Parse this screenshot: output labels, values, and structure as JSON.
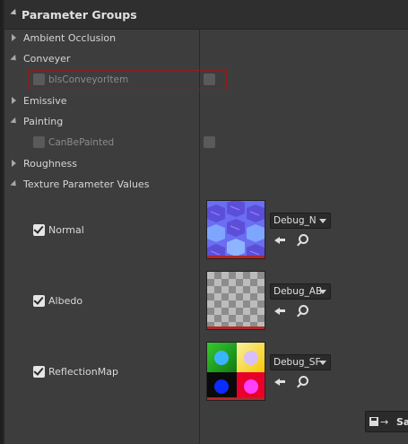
{
  "header": {
    "title": "Parameter Groups"
  },
  "groups": {
    "ambient_occlusion": "Ambient Occlusion",
    "conveyer": "Conveyer",
    "conveyer_param": "bIsConveyorItem",
    "emissive": "Emissive",
    "painting": "Painting",
    "painting_param": "CanBePainted",
    "roughness": "Roughness",
    "texture_params": "Texture Parameter Values"
  },
  "textures": [
    {
      "label": "Normal",
      "asset": "Debug_N",
      "checked": true
    },
    {
      "label": "Albedo",
      "asset": "Debug_AB",
      "checked": true
    },
    {
      "label": "ReflectionMap",
      "asset": "Debug_SF",
      "checked": true
    }
  ],
  "footer": {
    "save_label": "Sa"
  },
  "colors": {
    "highlight_border": "#8e1d1d",
    "thumb_underline": "#b02828"
  }
}
